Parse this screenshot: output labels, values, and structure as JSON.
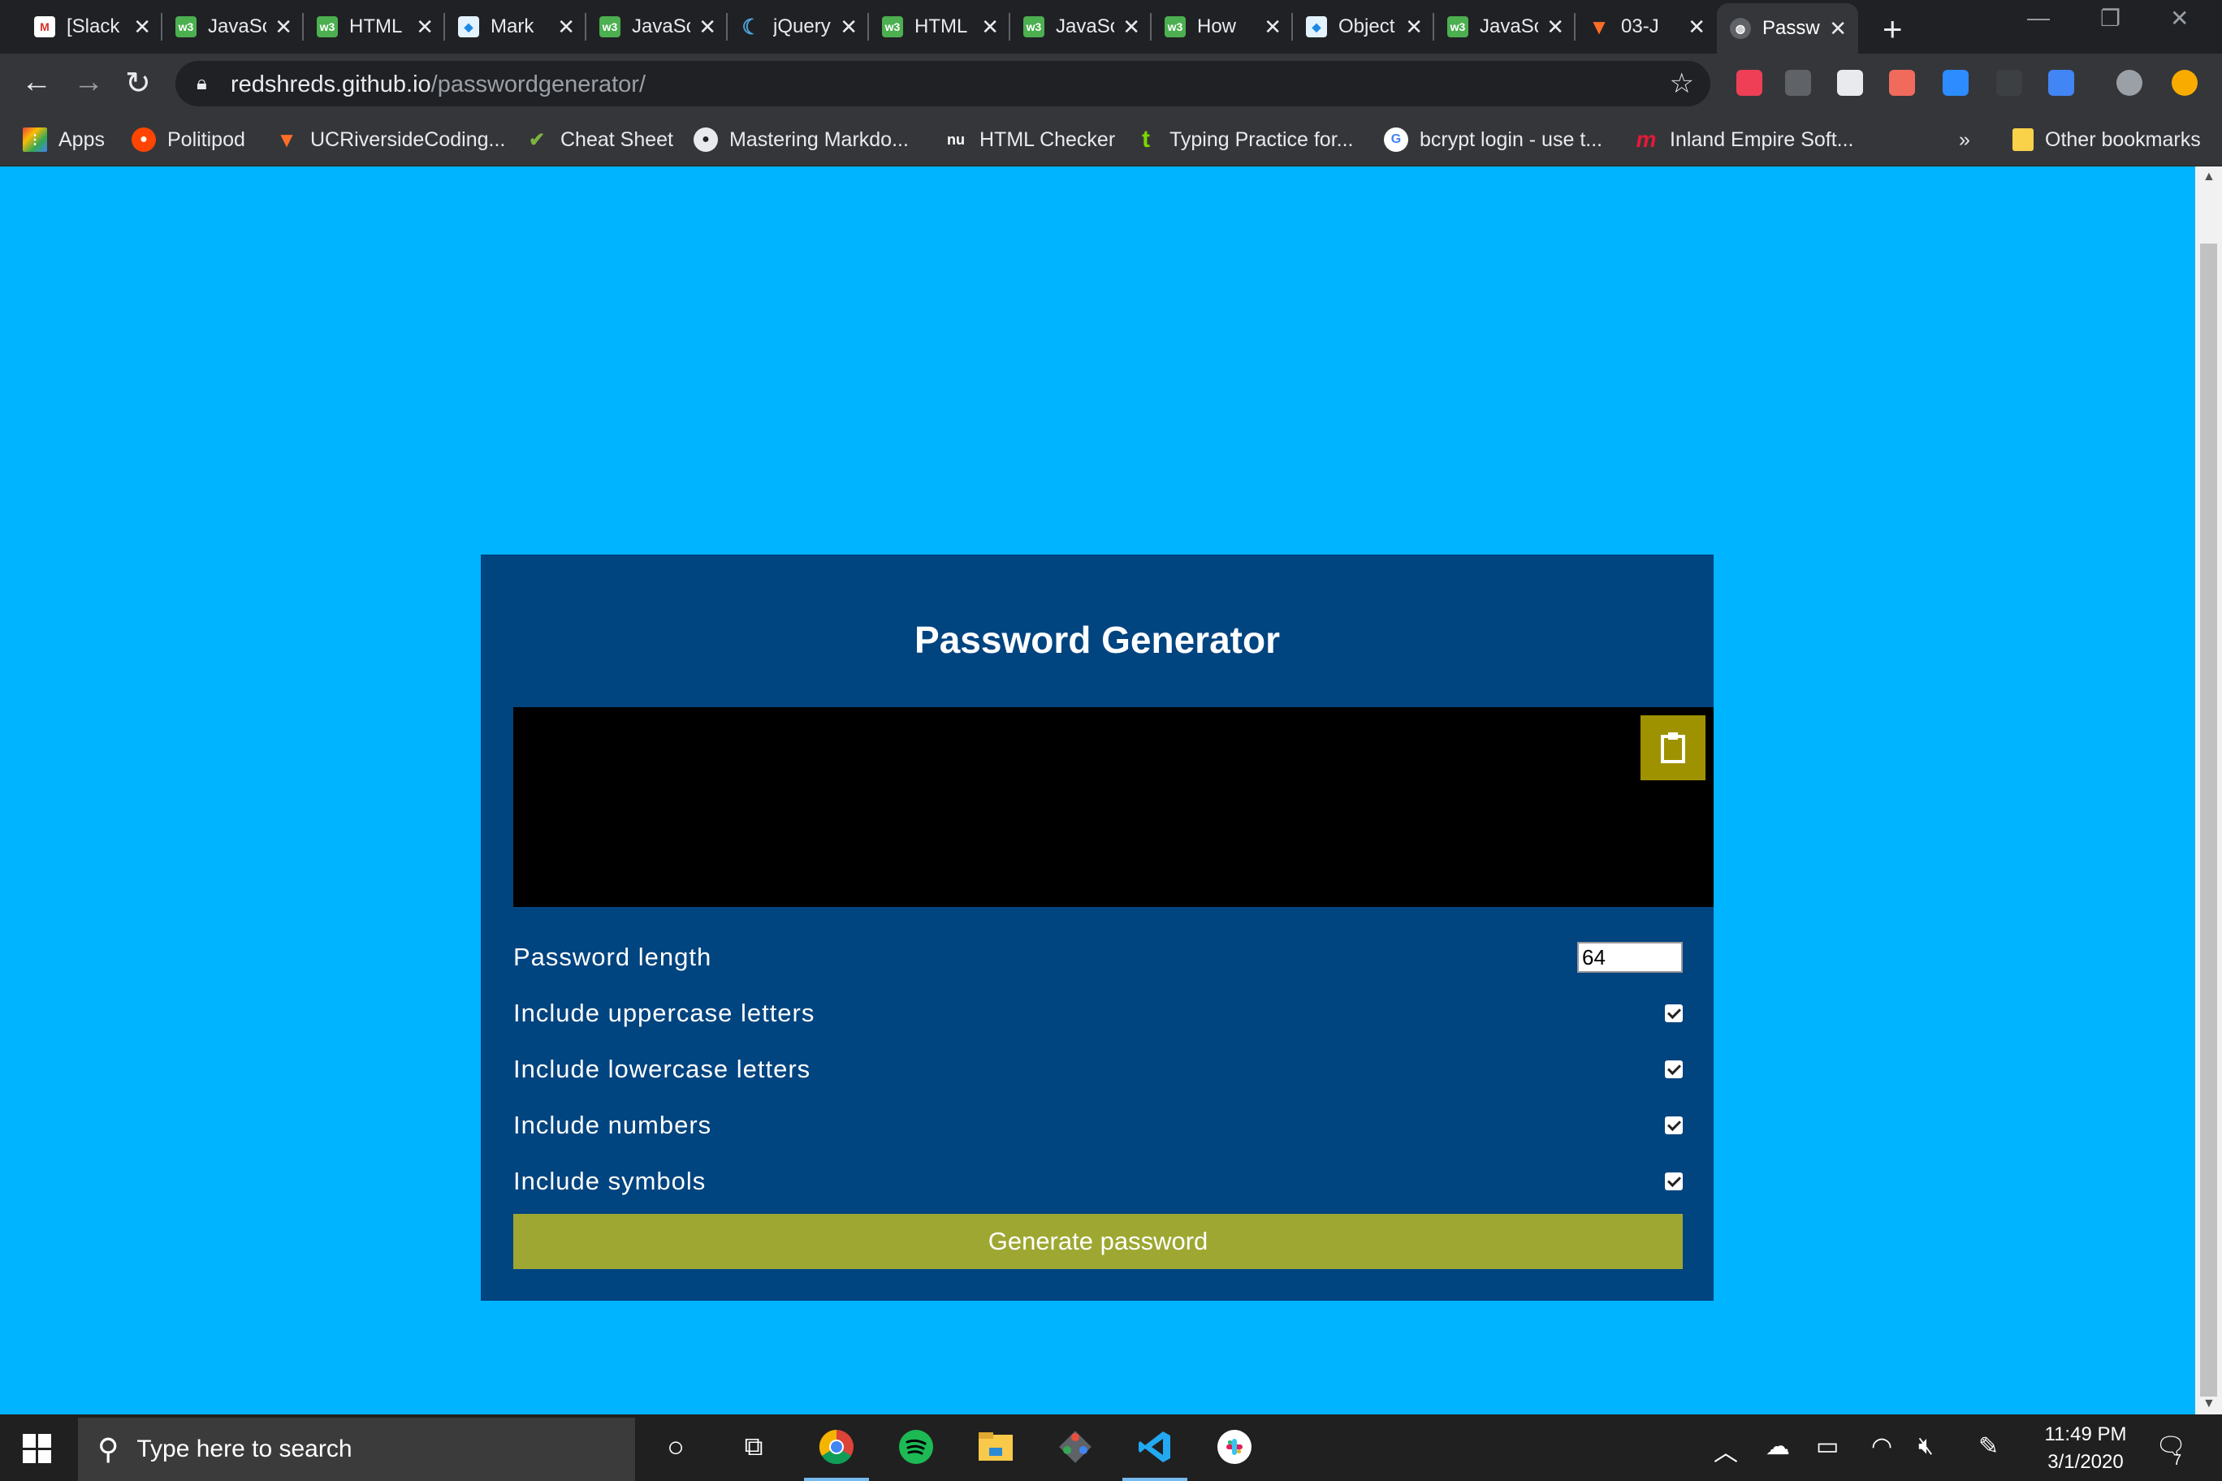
{
  "browser": {
    "tabs": [
      {
        "title": "[Slack",
        "icon": "gmail-icon",
        "color": "#d93025"
      },
      {
        "title": "JavaScript",
        "icon": "w3schools-icon",
        "color": "#4caf50"
      },
      {
        "title": "HTML",
        "icon": "w3schools-icon",
        "color": "#4caf50"
      },
      {
        "title": "Mark",
        "icon": "markdown-icon",
        "color": "#1e88e5"
      },
      {
        "title": "JavaScript",
        "icon": "w3schools-icon",
        "color": "#4caf50"
      },
      {
        "title": "jQuery",
        "icon": "jquery-icon",
        "color": "#0769ad"
      },
      {
        "title": "HTML",
        "icon": "w3schools-icon",
        "color": "#4caf50"
      },
      {
        "title": "JavaScript",
        "icon": "w3schools-icon",
        "color": "#4caf50"
      },
      {
        "title": "How",
        "icon": "w3schools-icon",
        "color": "#4caf50"
      },
      {
        "title": "Object",
        "icon": "markdown-icon",
        "color": "#1e88e5"
      },
      {
        "title": "JavaScript",
        "icon": "w3schools-icon",
        "color": "#4caf50"
      },
      {
        "title": "03-J",
        "icon": "gitlab-icon",
        "color": "#fc6d26"
      },
      {
        "title": "Passw",
        "icon": "globe-icon",
        "color": "#5f6368",
        "active": true
      }
    ],
    "url_domain": "redshreds.github.io",
    "url_path": "/passwordgenerator/",
    "bookmarks": [
      {
        "label": "Apps",
        "icon": "apps-grid-icon",
        "color": "#4285f4"
      },
      {
        "label": "Politipod",
        "icon": "reddit-icon",
        "color": "#ff4500"
      },
      {
        "label": "UCRiversideCoding...",
        "icon": "gitlab-icon",
        "color": "#fc6d26"
      },
      {
        "label": "Cheat Sheet",
        "icon": "cheatsheet-icon",
        "color": "#2e7d32"
      },
      {
        "label": "Mastering Markdo...",
        "icon": "github-icon",
        "color": "#333333"
      },
      {
        "label": "HTML Checker",
        "icon": "nu-icon",
        "color": "#35363a"
      },
      {
        "label": "Typing Practice for...",
        "icon": "typing-icon",
        "color": "#35363a"
      },
      {
        "label": "bcrypt login - use t...",
        "icon": "google-icon",
        "color": "#ffffff"
      },
      {
        "label": "Inland Empire Soft...",
        "icon": "meetup-icon",
        "color": "#e51937"
      }
    ],
    "overflow_label": "»",
    "other_bookmarks": "Other bookmarks"
  },
  "page": {
    "title": "Password Generator",
    "output_value": "",
    "length_label": "Password length",
    "length_value": "64",
    "options": [
      {
        "label": "Include uppercase letters",
        "checked": true
      },
      {
        "label": "Include lowercase letters",
        "checked": true
      },
      {
        "label": "Include numbers",
        "checked": true
      },
      {
        "label": "Include symbols",
        "checked": true
      }
    ],
    "generate_label": "Generate password",
    "colors": {
      "background": "#00b4ff",
      "card": "#004480",
      "button": "#9ea731",
      "copy_button": "#9e9200"
    }
  },
  "taskbar": {
    "search_placeholder": "Type here to search",
    "time": "11:49 PM",
    "date": "3/1/2020",
    "notification_count": "7"
  }
}
